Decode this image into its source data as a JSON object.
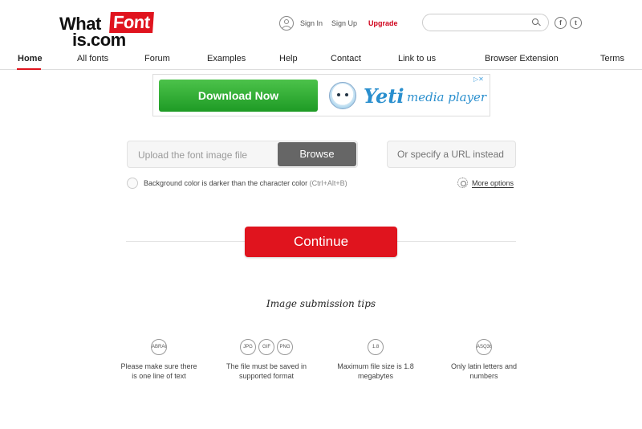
{
  "logo": {
    "word1": "What",
    "word2": "Font",
    "word3": "is.com"
  },
  "header": {
    "sign_in": "Sign In",
    "sign_up": "Sign Up",
    "upgrade": "Upgrade",
    "search_placeholder": "",
    "social": [
      "f",
      "t"
    ]
  },
  "nav": [
    "Home",
    "All fonts",
    "Forum",
    "Examples",
    "Help",
    "Contact",
    "Link to us",
    "Browser Extension",
    "Terms"
  ],
  "ad": {
    "button": "Download Now",
    "brand": "Yeti",
    "product": "media player",
    "choice": "▷✕"
  },
  "upload": {
    "label": "Upload the font image file",
    "browse": "Browse",
    "url_placeholder": "Or specify a URL instead"
  },
  "options": {
    "background_label": "Background color is darker than the character color",
    "shortcut": "(Ctrl+Alt+B)",
    "more": "More options"
  },
  "continue": "Continue",
  "tips": {
    "title": "Image submission tips",
    "items": [
      {
        "badges": [
          "ABRAC"
        ],
        "text1": "Please make sure there",
        "text2": "is one line of text"
      },
      {
        "badges": [
          "JPG",
          "GIF",
          "PNG"
        ],
        "text1": "The file must be saved in",
        "text2": "supported format"
      },
      {
        "badges": [
          "1.8"
        ],
        "text1": "Maximum file size is 1.8",
        "text2": "megabytes"
      },
      {
        "badges": [
          "ASQ36"
        ],
        "text1": "Only latin letters and",
        "text2": "numbers"
      }
    ]
  },
  "colors": {
    "brand_red": "#e0141e",
    "browse_gray": "#666666",
    "ad_green": "#1e9b25",
    "ad_blue": "#2a8fce"
  }
}
